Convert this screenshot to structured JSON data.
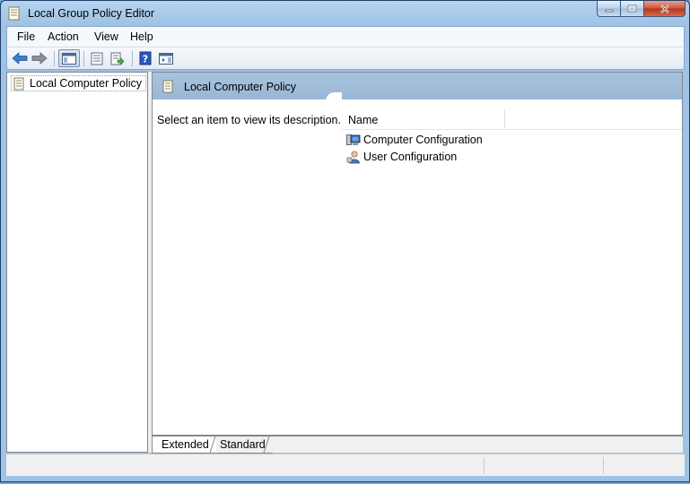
{
  "window": {
    "title": "Local Group Policy Editor",
    "controls": {
      "minimize": "minimize",
      "maximize": "maximize",
      "close": "close"
    }
  },
  "menu": {
    "items": [
      {
        "label": "File"
      },
      {
        "label": "Action"
      },
      {
        "label": "View"
      },
      {
        "label": "Help"
      }
    ]
  },
  "toolbar": {
    "buttons": [
      {
        "icon": "back-arrow-icon"
      },
      {
        "icon": "forward-arrow-icon"
      },
      {
        "icon": "show-hide-console-tree-icon",
        "pressed": true
      },
      {
        "icon": "properties-icon"
      },
      {
        "icon": "export-list-icon"
      },
      {
        "icon": "help-icon"
      },
      {
        "icon": "show-hide-action-pane-icon"
      }
    ]
  },
  "tree": {
    "root_label": "Local Computer Policy",
    "root_icon": "policy-scroll-icon"
  },
  "content": {
    "header_title": "Local Computer Policy",
    "description": "Select an item to view its description.",
    "columns": [
      {
        "label": "Name"
      }
    ],
    "rows": [
      {
        "label": "Computer Configuration",
        "icon": "computer-configuration-icon"
      },
      {
        "label": "User Configuration",
        "icon": "user-configuration-icon"
      }
    ]
  },
  "tabs": [
    {
      "label": "Extended",
      "active": true
    },
    {
      "label": "Standard",
      "active": false
    }
  ],
  "colors": {
    "titlebar": "#9fc3e6",
    "content_header": "#a9c3dc",
    "close_button": "#c8553c"
  }
}
